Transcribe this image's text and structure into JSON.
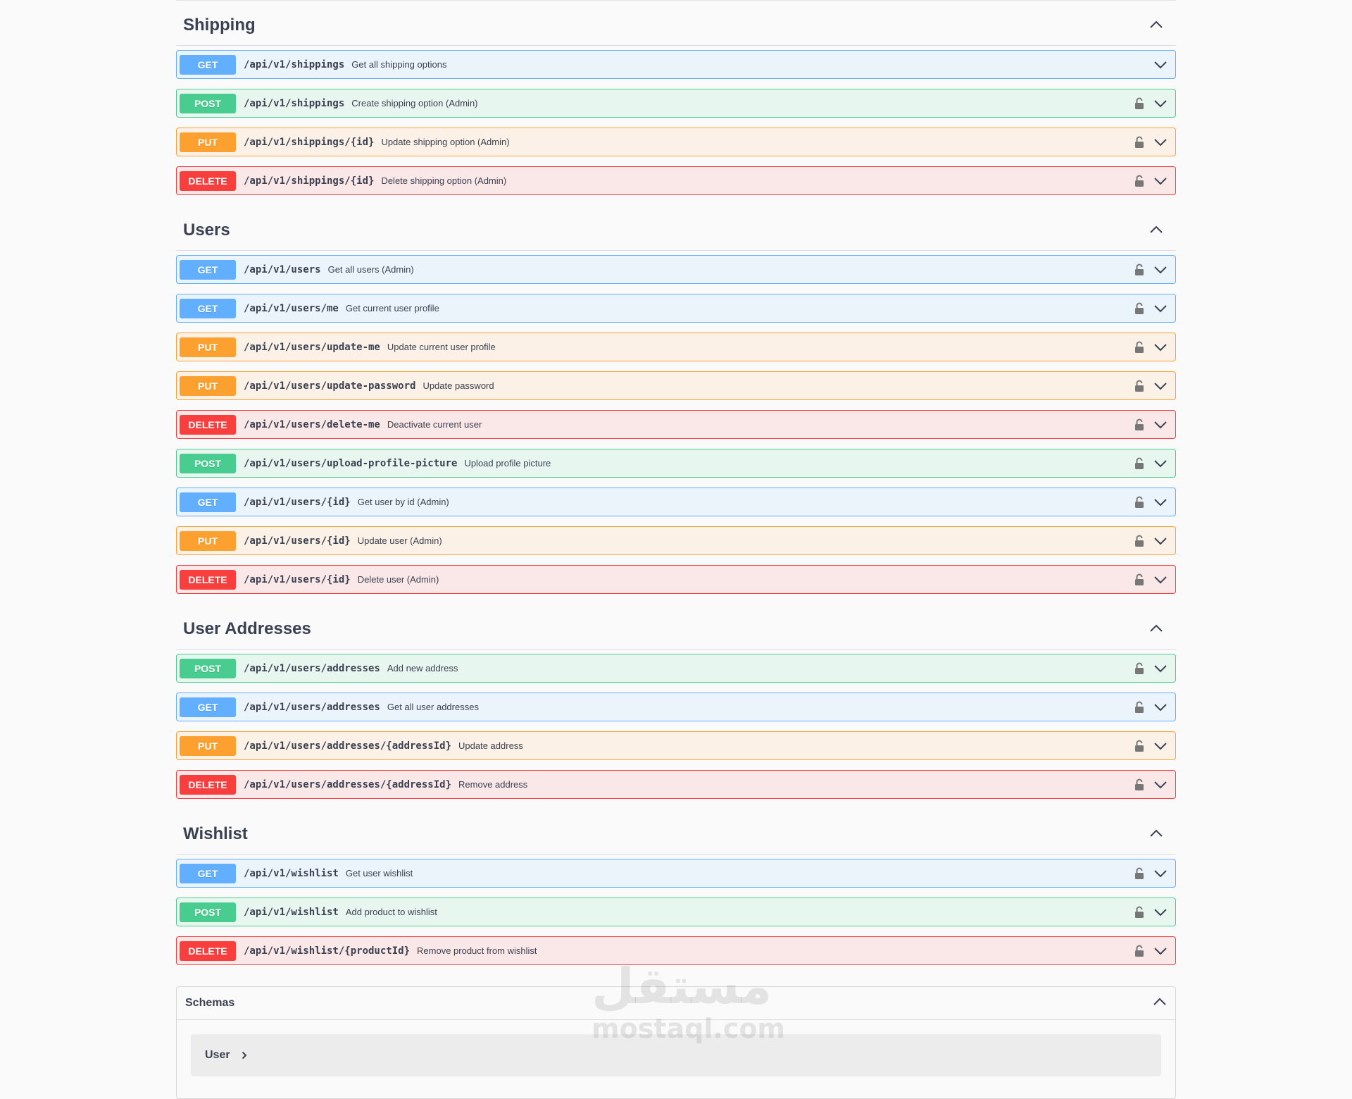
{
  "colors": {
    "get": "#61affe",
    "post": "#49cc90",
    "put": "#fca130",
    "delete": "#f93e3e"
  },
  "sections": [
    {
      "title": "Shipping",
      "operations": [
        {
          "method": "GET",
          "path": "/api/v1/shippings",
          "summary": "Get all shipping options",
          "locked": false
        },
        {
          "method": "POST",
          "path": "/api/v1/shippings",
          "summary": "Create shipping option (Admin)",
          "locked": true
        },
        {
          "method": "PUT",
          "path": "/api/v1/shippings/{id}",
          "summary": "Update shipping option (Admin)",
          "locked": true
        },
        {
          "method": "DELETE",
          "path": "/api/v1/shippings/{id}",
          "summary": "Delete shipping option (Admin)",
          "locked": true
        }
      ]
    },
    {
      "title": "Users",
      "operations": [
        {
          "method": "GET",
          "path": "/api/v1/users",
          "summary": "Get all users (Admin)",
          "locked": true
        },
        {
          "method": "GET",
          "path": "/api/v1/users/me",
          "summary": "Get current user profile",
          "locked": true
        },
        {
          "method": "PUT",
          "path": "/api/v1/users/update-me",
          "summary": "Update current user profile",
          "locked": true
        },
        {
          "method": "PUT",
          "path": "/api/v1/users/update-password",
          "summary": "Update password",
          "locked": true
        },
        {
          "method": "DELETE",
          "path": "/api/v1/users/delete-me",
          "summary": "Deactivate current user",
          "locked": true
        },
        {
          "method": "POST",
          "path": "/api/v1/users/upload-profile-picture",
          "summary": "Upload profile picture",
          "locked": true
        },
        {
          "method": "GET",
          "path": "/api/v1/users/{id}",
          "summary": "Get user by id (Admin)",
          "locked": true
        },
        {
          "method": "PUT",
          "path": "/api/v1/users/{id}",
          "summary": "Update user (Admin)",
          "locked": true
        },
        {
          "method": "DELETE",
          "path": "/api/v1/users/{id}",
          "summary": "Delete user (Admin)",
          "locked": true
        }
      ]
    },
    {
      "title": "User Addresses",
      "operations": [
        {
          "method": "POST",
          "path": "/api/v1/users/addresses",
          "summary": "Add new address",
          "locked": true
        },
        {
          "method": "GET",
          "path": "/api/v1/users/addresses",
          "summary": "Get all user addresses",
          "locked": true
        },
        {
          "method": "PUT",
          "path": "/api/v1/users/addresses/{addressId}",
          "summary": "Update address",
          "locked": true
        },
        {
          "method": "DELETE",
          "path": "/api/v1/users/addresses/{addressId}",
          "summary": "Remove address",
          "locked": true
        }
      ]
    },
    {
      "title": "Wishlist",
      "operations": [
        {
          "method": "GET",
          "path": "/api/v1/wishlist",
          "summary": "Get user wishlist",
          "locked": true
        },
        {
          "method": "POST",
          "path": "/api/v1/wishlist",
          "summary": "Add product to wishlist",
          "locked": true
        },
        {
          "method": "DELETE",
          "path": "/api/v1/wishlist/{productId}",
          "summary": "Remove product from wishlist",
          "locked": true
        }
      ]
    }
  ],
  "schemas": {
    "title": "Schemas",
    "models": [
      "User"
    ]
  },
  "watermark": {
    "arabic": "مستقل",
    "latin": "mostaql.com"
  }
}
